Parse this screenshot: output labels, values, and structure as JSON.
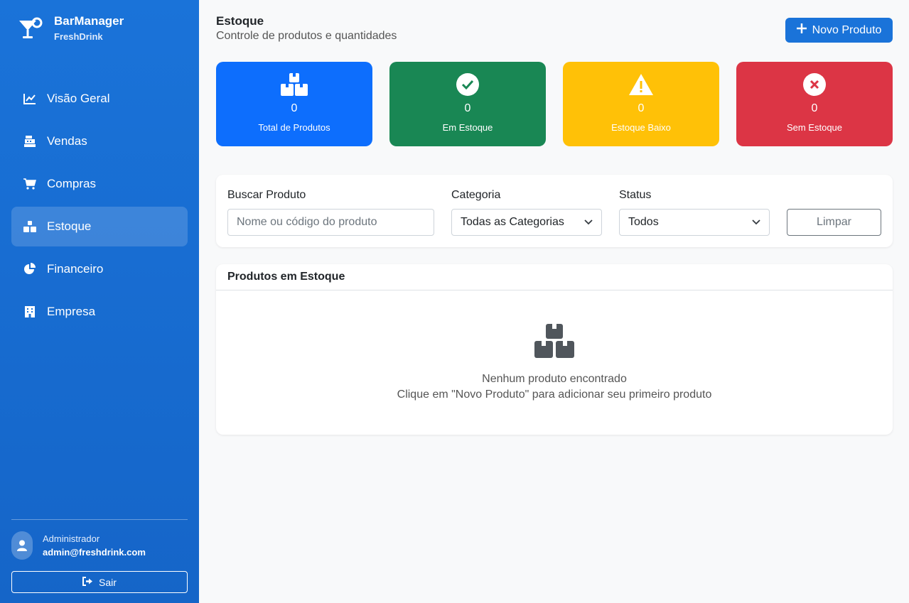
{
  "brand": {
    "title": "BarManager",
    "subtitle": "FreshDrink"
  },
  "nav": [
    {
      "label": "Visão Geral",
      "icon": "chart-line-icon"
    },
    {
      "label": "Vendas",
      "icon": "cash-register-icon"
    },
    {
      "label": "Compras",
      "icon": "cart-icon"
    },
    {
      "label": "Estoque",
      "icon": "boxes-icon",
      "active": true
    },
    {
      "label": "Financeiro",
      "icon": "pie-chart-icon"
    },
    {
      "label": "Empresa",
      "icon": "building-icon"
    }
  ],
  "user": {
    "name": "Administrador",
    "email": "admin@freshdrink.com",
    "logout_label": "Sair"
  },
  "header": {
    "title": "Estoque",
    "subtitle": "Controle de produtos e quantidades",
    "new_button": "Novo Produto"
  },
  "stats": [
    {
      "value": "0",
      "label": "Total de Produtos",
      "color": "#0d6efd",
      "icon": "boxes-icon"
    },
    {
      "value": "0",
      "label": "Em Estoque",
      "color": "#198754",
      "icon": "check-circle-icon"
    },
    {
      "value": "0",
      "label": "Estoque Baixo",
      "color": "#ffc107",
      "icon": "warning-icon"
    },
    {
      "value": "0",
      "label": "Sem Estoque",
      "color": "#dc3545",
      "icon": "x-circle-icon"
    }
  ],
  "filters": {
    "search_label": "Buscar Produto",
    "search_placeholder": "Nome ou código do produto",
    "category_label": "Categoria",
    "category_value": "Todas as Categorias",
    "status_label": "Status",
    "status_value": "Todos",
    "clear_label": "Limpar"
  },
  "table": {
    "title": "Produtos em Estoque",
    "empty_title": "Nenhum produto encontrado",
    "empty_sub": "Clique em \"Novo Produto\" para adicionar seu primeiro produto"
  }
}
